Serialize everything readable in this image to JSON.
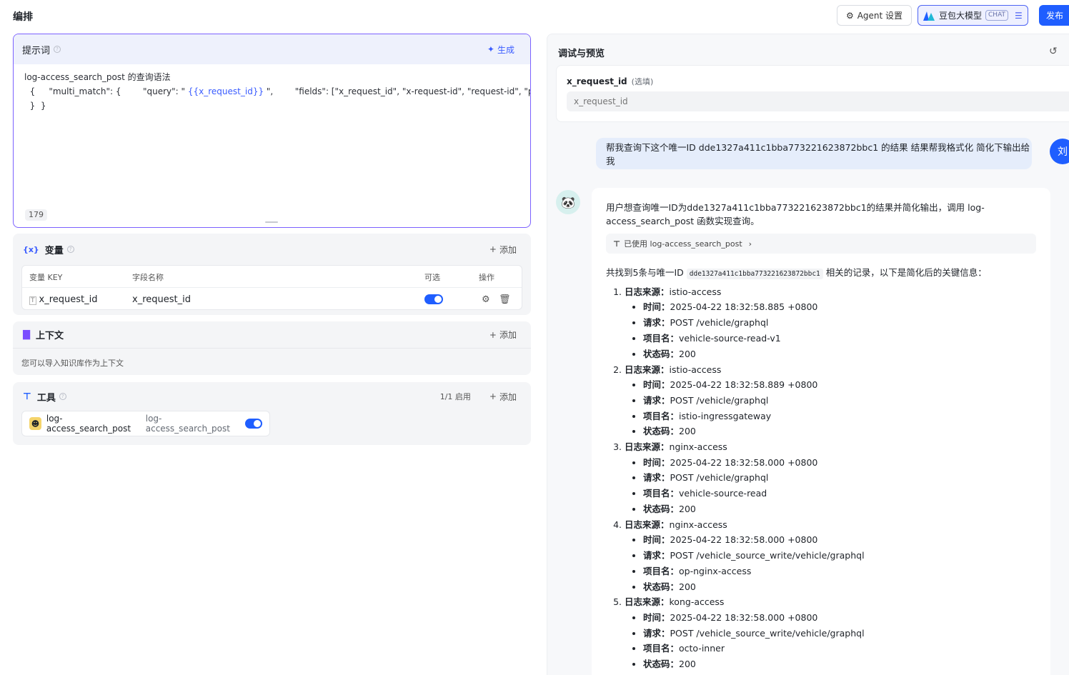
{
  "header": {
    "title": "编排",
    "agent_settings_label": "Agent 设置",
    "model_label": "豆包大模型",
    "model_tag": "CHAT",
    "publish_label": "发布"
  },
  "prompt": {
    "title": "提示词",
    "generate_label": "生成",
    "line1": "log-access_search_post 的查询语法",
    "line2_pre": "  {     \"multi_match\": {        \"query\": \" ",
    "line2_var": "{{x_request_id}}",
    "line2_post": " \",        \"fields\": [\"x_request_id\", \"x-request-id\", \"request-id\", \"p-request-id\"]",
    "line3": "  }  }",
    "char_count": "179"
  },
  "variables": {
    "title": "变量",
    "add_label": "添加",
    "col_key": "变量 KEY",
    "col_name": "字段名称",
    "col_optional": "可选",
    "col_actions": "操作",
    "rows": [
      {
        "key": "x_request_id",
        "name": "x_request_id",
        "optional": true
      }
    ]
  },
  "context": {
    "title": "上下文",
    "add_label": "添加",
    "hint": "您可以导入知识库作为上下文"
  },
  "tools": {
    "title": "工具",
    "status": "1/1 启用",
    "add_label": "添加",
    "items": [
      {
        "name": "log-access_search_post",
        "desc": "log-access_search_post",
        "enabled": true
      }
    ]
  },
  "debug": {
    "title": "调试与预览",
    "var_label": "x_request_id",
    "var_optional": "(选填)",
    "var_placeholder": "x_request_id",
    "user_avatar": "刘",
    "user_message": "帮我查询下这个唯一ID dde1327a411c1bba773221623872bbc1 的结果 结果帮我格式化 简化下输出给我",
    "bot_intro": "用户想查询唯一ID为dde1327a411c1bba773221623872bbc1的结果并简化输出，调用 log-access_search_post 函数实现查询。",
    "tool_used": "已使用 log-access_search_post",
    "summary_pre": "共找到5条与唯一ID ",
    "summary_code": "dde1327a411c1bba773221623872bbc1",
    "summary_post": " 相关的记录，以下是简化后的关键信息：",
    "labels": {
      "source": "日志来源：",
      "time": "时间：",
      "request": "请求：",
      "project": "项目名：",
      "status": "状态码："
    },
    "logs": [
      {
        "source": "istio-access",
        "time": "2025-04-22 18:32:58.885 +0800",
        "request": "POST /vehicle/graphql",
        "project": "vehicle-source-read-v1",
        "status": "200"
      },
      {
        "source": "istio-access",
        "time": "2025-04-22 18:32:58.889 +0800",
        "request": "POST /vehicle/graphql",
        "project": "istio-ingressgateway",
        "status": "200"
      },
      {
        "source": "nginx-access",
        "time": "2025-04-22 18:32:58.000 +0800",
        "request": "POST /vehicle/graphql",
        "project": "vehicle-source-read",
        "status": "200"
      },
      {
        "source": "nginx-access",
        "time": "2025-04-22 18:32:58.000 +0800",
        "request": "POST /vehicle_source_write/vehicle/graphql",
        "project": "op-nginx-access",
        "status": "200"
      },
      {
        "source": "kong-access",
        "time": "2025-04-22 18:32:58.000 +0800",
        "request": "POST /vehicle_source_write/vehicle/graphql",
        "project": "octo-inner",
        "status": "200"
      }
    ]
  }
}
